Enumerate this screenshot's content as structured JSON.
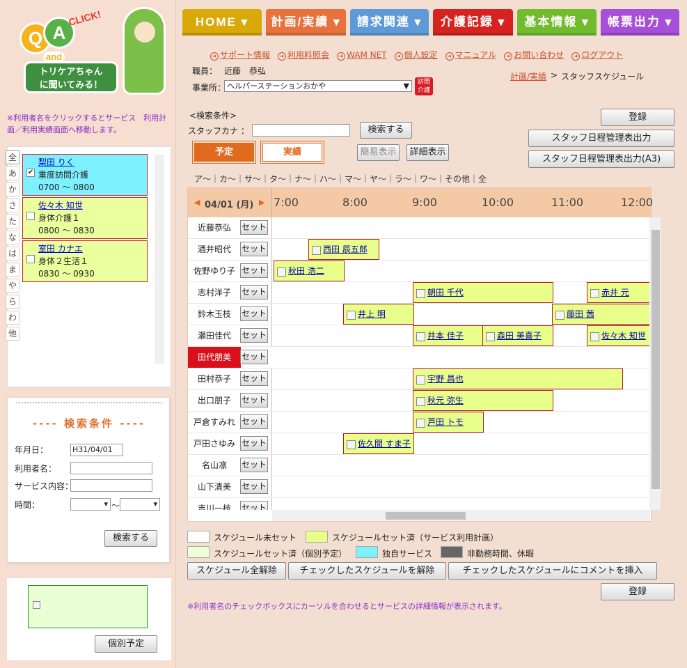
{
  "logo": {
    "q": "Q",
    "a": "A",
    "click": "CLICK!",
    "and": "and",
    "line1": "トリケアちゃん",
    "line2": "に聞いてみる！"
  },
  "sidebar": {
    "notice": "※利用者名をクリックするとサービス　利用計画／利用実績画面へ移動します。",
    "kana_tabs": [
      "全",
      "あ",
      "か",
      "さ",
      "た",
      "な",
      "は",
      "ま",
      "や",
      "ら",
      "わ",
      "他"
    ],
    "users": [
      {
        "name": "梨田 りく",
        "service": "重度訪問介護",
        "time": "0700 ～ 0800",
        "checked": "✔"
      },
      {
        "name": "佐々木 知世",
        "service": "身体介護１",
        "time": "0800 ～ 0830",
        "checked": ""
      },
      {
        "name": "室田 カナエ",
        "service": "身体２生活１",
        "time": "0830 ～ 0930",
        "checked": ""
      }
    ],
    "search": {
      "title": "---- 検索条件 ----",
      "date_label": "年月日：",
      "date_value": "H31/04/01",
      "user_label": "利用者名：",
      "service_label": "サービス内容：",
      "time_label": "時間：",
      "tilde": "〜",
      "button": "検索する"
    },
    "indiv_button": "個別予定"
  },
  "nav": [
    {
      "label": "HOME ▾",
      "color": "#d9a90a"
    },
    {
      "label": "計画/実績 ▾",
      "color": "#e8723d"
    },
    {
      "label": "請求関連 ▾",
      "color": "#5f9ad8"
    },
    {
      "label": "介護記録 ▾",
      "color": "#d6231f"
    },
    {
      "label": "基本情報 ▾",
      "color": "#71bb2f"
    },
    {
      "label": "帳票出力 ▾",
      "color": "#a64fd8"
    }
  ],
  "links": [
    "サポート情報",
    "利用料照会",
    "WAM NET",
    "個人設定",
    "マニュアル",
    "お問い合わせ",
    "ログアウト"
  ],
  "header": {
    "staff_label": "職員：",
    "staff_name": "近藤　恭弘",
    "office_label": "事業所：",
    "office_value": "ヘルパーステーションおかや",
    "badge": "訪問介護",
    "breadcrumb_link": "計画/実績",
    "breadcrumb_sep": ">",
    "breadcrumb_current": "スタッフスケジュール"
  },
  "search_cond": {
    "label": "<検索条件>",
    "kana_label": "スタッフカナ ：",
    "button": "検索する"
  },
  "buttons": {
    "register": "登録",
    "out1": "スタッフ日程管理表出力",
    "out2": "スタッフ日程管理表出力(A3)",
    "yotei": "予定",
    "jisseki": "実績",
    "simple": "簡易表示",
    "detail": "詳細表示"
  },
  "kana_filter": "ア～｜カ～｜サ～｜タ～｜ナ～｜ハ～｜マ～｜ヤ～｜ラ～｜ワ～｜その他｜全",
  "grid": {
    "date": "04/01 (月)",
    "hours": [
      "7:00",
      "8:00",
      "9:00",
      "10:00",
      "11:00",
      "12:00"
    ],
    "set_label": "セット",
    "staff": [
      "近藤恭弘",
      "酒井昭代",
      "佐野ゆり子",
      "志村洋子",
      "鈴木玉枝",
      "瀬田佳代",
      "田代朋美",
      "田村恭子",
      "出口朋子",
      "戸倉すみれ",
      "戸田さゆみ",
      "名山凛",
      "山下清美",
      "吉川一枝"
    ],
    "events": {
      "sakai": "西田 辰五郎",
      "sano": "秋田 浩二",
      "shimura1": "朝田 千代",
      "shimura2": "赤井 元",
      "suzuki1": "井上 明",
      "suzuki2": "藤田 茜",
      "seta1": "井本 佳子",
      "seta2": "森田 美喜子",
      "seta3": "佐々木 知世",
      "tamura": "宇野 昌也",
      "deguchi": "秋元 弥生",
      "tokura": "芦田 トモ",
      "toda": "佐久間 すま子"
    }
  },
  "legend": {
    "unset": "スケジュール未セット",
    "plan": "スケジュールセット済（サービス利用計画）",
    "indiv": "スケジュールセット済（個別予定）",
    "own": "独自サービス",
    "off": "非勤務時間、休暇"
  },
  "bottom": {
    "b1": "スケジュール全解除",
    "b2": "チェックしたスケジュールを解除",
    "b3": "チェックしたスケジュールにコメントを挿入",
    "register": "登録",
    "note": "※利用者名のチェックボックスにカーソルを合わせるとサービスの詳細情報が表示されます。"
  }
}
